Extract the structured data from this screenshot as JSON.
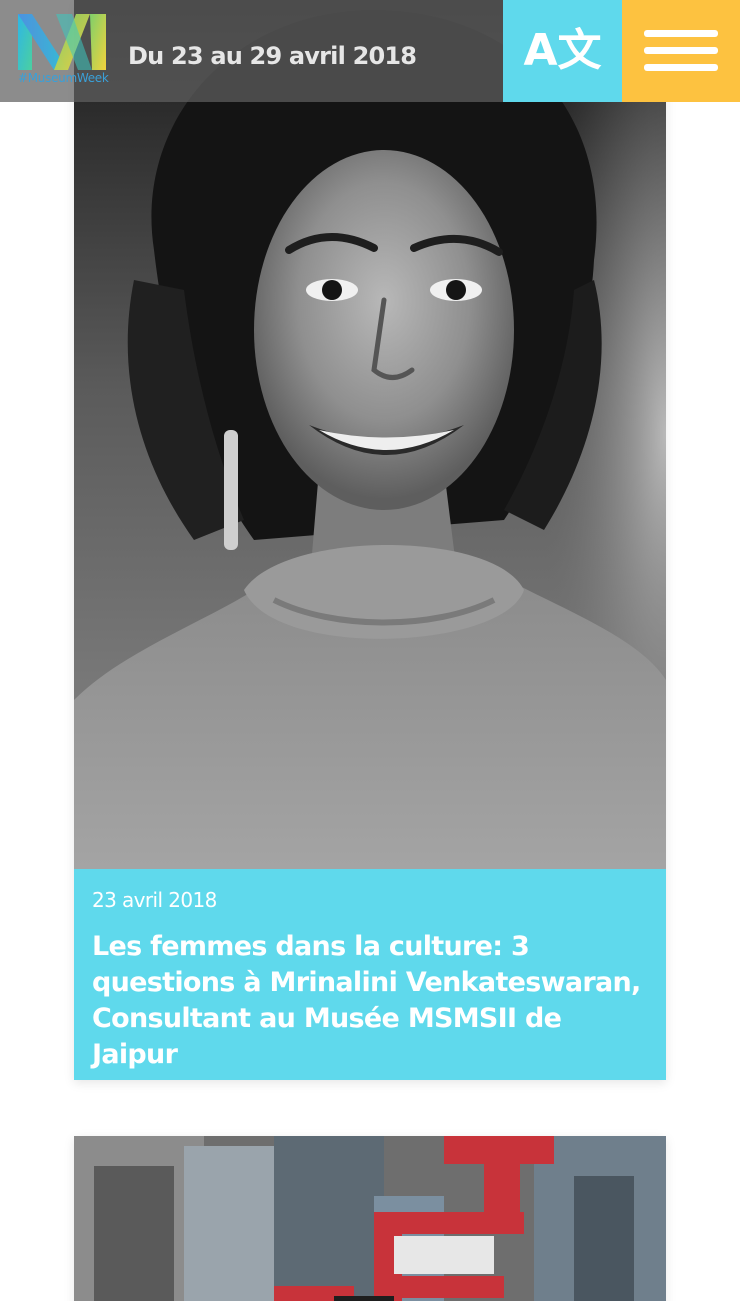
{
  "header": {
    "logo_text": "#MuseumWeek",
    "dates": "Du 23 au 29 avril 2018",
    "translate_label": "A文",
    "translate_icon": "translate-icon",
    "menu_icon": "hamburger-menu-icon"
  },
  "colors": {
    "cyan": "#5fd9ec",
    "yellow": "#fdc240",
    "header_bg": "#5f5f5f"
  },
  "articles": [
    {
      "date": "23 avril 2018",
      "title": "Les femmes dans la culture: 3 questions à Mrinalini Venkateswaran, Consultant au Musée MSMSII de Jaipur"
    }
  ]
}
